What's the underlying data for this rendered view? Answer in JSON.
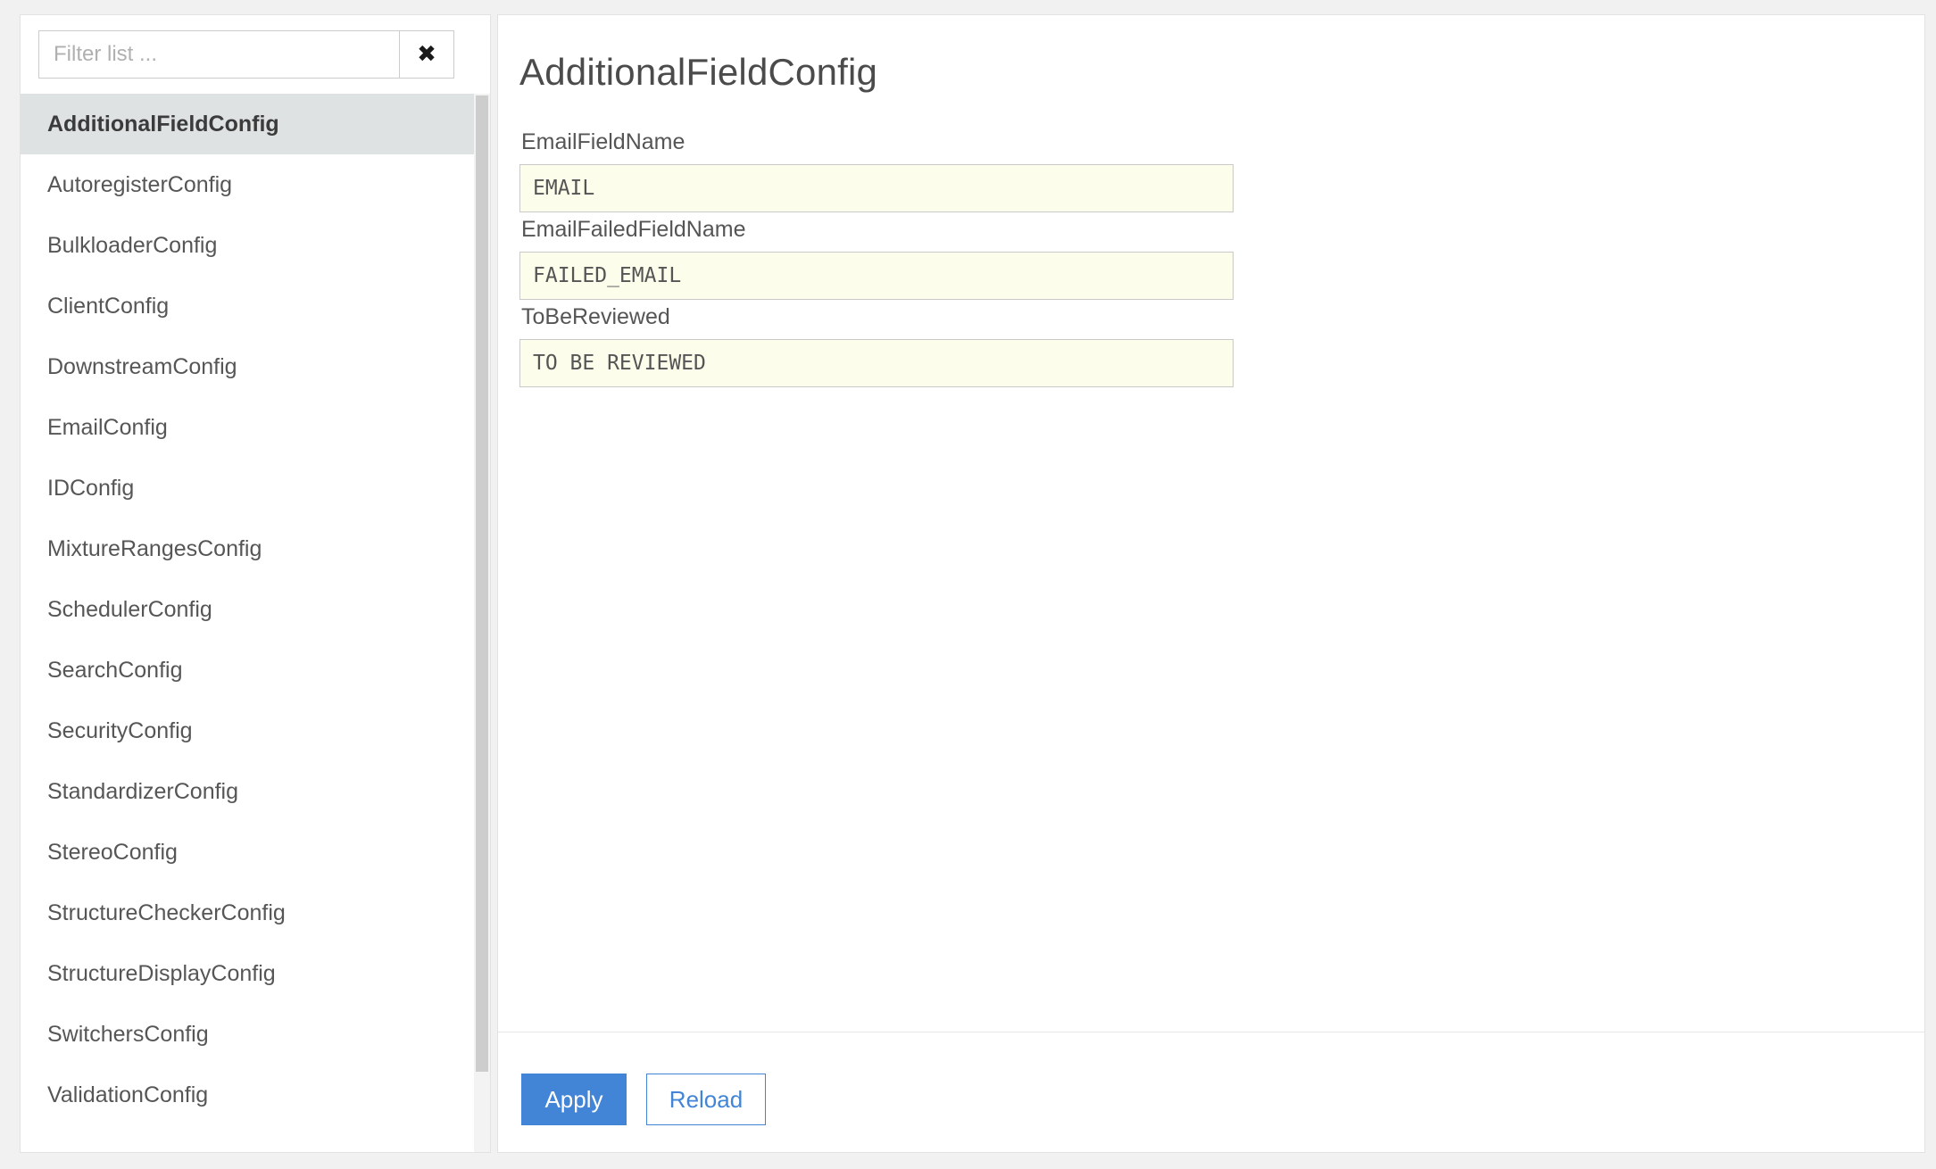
{
  "sidebar": {
    "filter": {
      "placeholder": "Filter list ...",
      "value": "",
      "clear_icon": "close-x-icon",
      "clear_glyph": "✖"
    },
    "selected_index": 0,
    "items": [
      {
        "label": "AdditionalFieldConfig"
      },
      {
        "label": "AutoregisterConfig"
      },
      {
        "label": "BulkloaderConfig"
      },
      {
        "label": "ClientConfig"
      },
      {
        "label": "DownstreamConfig"
      },
      {
        "label": "EmailConfig"
      },
      {
        "label": "IDConfig"
      },
      {
        "label": "MixtureRangesConfig"
      },
      {
        "label": "SchedulerConfig"
      },
      {
        "label": "SearchConfig"
      },
      {
        "label": "SecurityConfig"
      },
      {
        "label": "StandardizerConfig"
      },
      {
        "label": "StereoConfig"
      },
      {
        "label": "StructureCheckerConfig"
      },
      {
        "label": "StructureDisplayConfig"
      },
      {
        "label": "SwitchersConfig"
      },
      {
        "label": "ValidationConfig"
      }
    ]
  },
  "main": {
    "title": "AdditionalFieldConfig",
    "fields": [
      {
        "label": "EmailFieldName",
        "value": "EMAIL"
      },
      {
        "label": "EmailFailedFieldName",
        "value": "FAILED_EMAIL"
      },
      {
        "label": "ToBeReviewed",
        "value": "TO BE REVIEWED"
      }
    ],
    "footer": {
      "apply_label": "Apply",
      "reload_label": "Reload"
    }
  },
  "colors": {
    "accent": "#4285d6",
    "selected_row": "#dee2e3",
    "input_background": "#fdfdeb",
    "page_background": "#f1f1f1"
  }
}
